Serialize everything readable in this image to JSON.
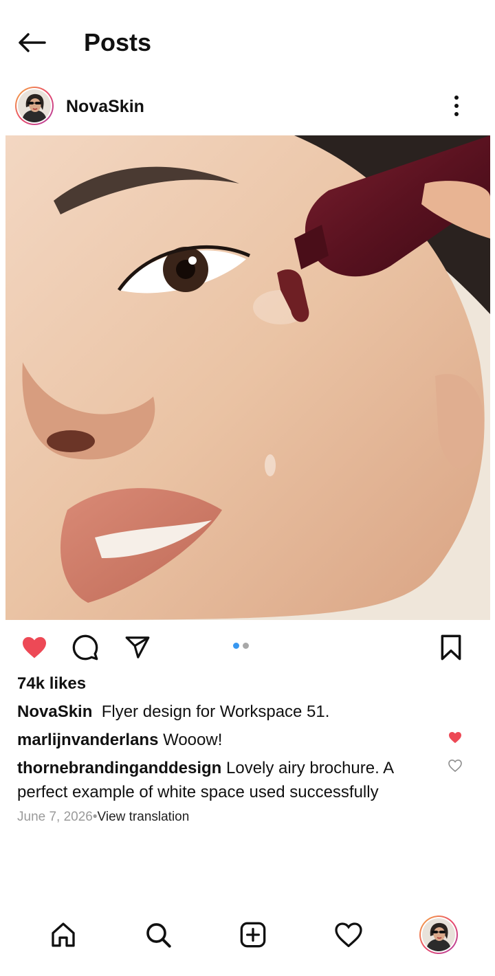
{
  "header": {
    "title": "Posts",
    "back_icon": "arrow-left-icon"
  },
  "post": {
    "username": "NovaSkin",
    "more_icon": "more-vertical-icon",
    "image_alt": "photo of a woman with a burgundy tube dispensing serum on her cheek",
    "liked": true,
    "carousel": {
      "total": 2,
      "current": 1
    },
    "likes_text": "74k likes",
    "caption": {
      "username": "NovaSkin",
      "text": "Flyer design for Workspace 51."
    },
    "comments": [
      {
        "username": "marlijnvanderlans",
        "text": "Wooow!",
        "liked": true
      },
      {
        "username": "thornebrandinganddesign",
        "text": "Lovely airy brochure. A perfect example of white space used successfully",
        "liked": false
      }
    ],
    "date": "June 7, 2026",
    "separator": "•",
    "view_translation": "View translation"
  },
  "colors": {
    "like_red": "#ed4956",
    "carousel_active": "#3897f0",
    "carousel_inactive": "#a8a8a8",
    "meta_gray": "#9a9a9a"
  },
  "nav": [
    {
      "name": "home",
      "icon": "home-icon"
    },
    {
      "name": "search",
      "icon": "search-icon"
    },
    {
      "name": "create",
      "icon": "plus-square-icon"
    },
    {
      "name": "activity",
      "icon": "heart-icon"
    },
    {
      "name": "profile",
      "icon": "avatar"
    }
  ]
}
